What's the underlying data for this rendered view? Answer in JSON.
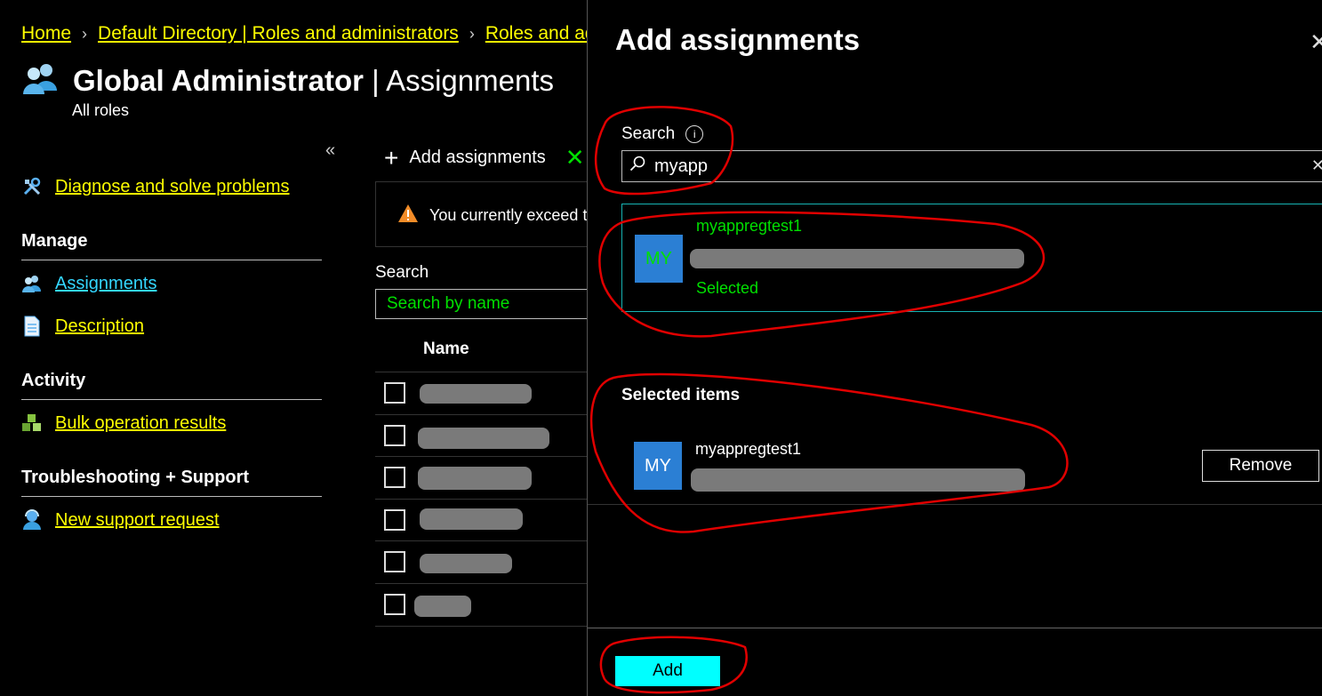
{
  "breadcrumb": [
    "Home",
    "Default Directory | Roles and administrators",
    "Roles and ad"
  ],
  "page": {
    "title_bold": "Global Administrator",
    "title_sep": " | ",
    "title_light": "Assignments",
    "subtitle": "All roles"
  },
  "sidebar": {
    "diagnose": "Diagnose and solve problems",
    "manage_header": "Manage",
    "assignments": "Assignments",
    "description": "Description",
    "activity_header": "Activity",
    "bulk": "Bulk operation results",
    "troubleshoot_header": "Troubleshooting + Support",
    "support": "New support request"
  },
  "toolbar": {
    "add_assignments": "Add assignments"
  },
  "warning": {
    "text": "You currently exceed th"
  },
  "grid": {
    "search_label": "Search",
    "search_placeholder": "Search by name",
    "name_header": "Name"
  },
  "panel": {
    "title": "Add assignments",
    "search_label": "Search",
    "search_value": "myapp",
    "result": {
      "avatar": "MY",
      "name": "myappregtest1",
      "status": "Selected"
    },
    "selected_header": "Selected items",
    "selected_item": {
      "avatar": "MY",
      "name": "myappregtest1"
    },
    "remove_label": "Remove",
    "add_label": "Add"
  },
  "colors": {
    "link": "#ffff00",
    "selected_green": "#00e000",
    "accent_cyan": "#00ffff",
    "avatar_blue": "#2b7fd4",
    "annotation_red": "#e00000"
  }
}
